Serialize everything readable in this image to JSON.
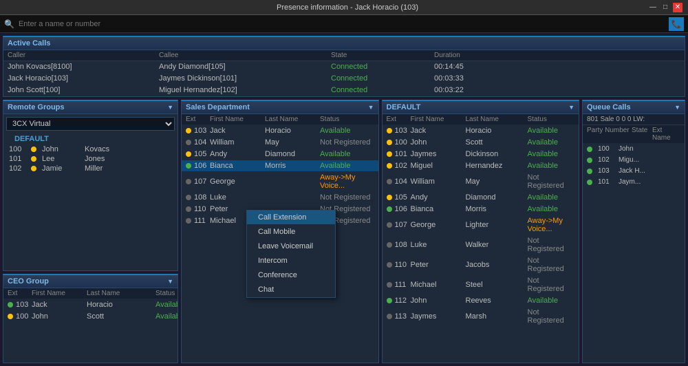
{
  "titlebar": {
    "title": "Presence information - Jack Horacio (103)",
    "min_btn": "—",
    "max_btn": "□",
    "close_btn": "✕"
  },
  "search": {
    "placeholder": "Enter a name or number"
  },
  "active_calls": {
    "label": "Active Calls",
    "headers": [
      "Caller",
      "Callee",
      "State",
      "Duration"
    ],
    "rows": [
      {
        "caller": "John Kovacs[8100]",
        "callee": "Andy Diamond[105]",
        "state": "Connected",
        "duration": "00:14:45"
      },
      {
        "caller": "Jack Horacio[103]",
        "callee": "Jaymes Dickinson[101]",
        "state": "Connected",
        "duration": "00:03:33"
      },
      {
        "caller": "John Scott[100]",
        "callee": "Miguel Hernandez[102]",
        "state": "Connected",
        "duration": "00:03:22"
      }
    ]
  },
  "remote_groups": {
    "label": "Remote Groups",
    "dropdown": "3CX Virtual",
    "group_name": "DEFAULT",
    "members": [
      {
        "ext": "100",
        "first": "John",
        "last": "Kovacs",
        "status": "yellow"
      },
      {
        "ext": "101",
        "first": "Lee",
        "last": "Jones",
        "status": "yellow"
      },
      {
        "ext": "102",
        "first": "Jamie",
        "last": "Miller",
        "status": "yellow"
      }
    ]
  },
  "ceo_group": {
    "label": "CEO Group",
    "headers": [
      "Ext",
      "First Name",
      "Last Name",
      "Status"
    ],
    "rows": [
      {
        "ext": "103",
        "first": "Jack",
        "last": "Horacio",
        "status": "Available",
        "dot": "green"
      },
      {
        "ext": "100",
        "first": "John",
        "last": "Scott",
        "status": "Available",
        "dot": "yellow"
      }
    ]
  },
  "sales_dept": {
    "label": "Sales Department",
    "headers": [
      "Ext",
      "First Name",
      "Last Name",
      "Status"
    ],
    "rows": [
      {
        "ext": "103",
        "first": "Jack",
        "last": "Horacio",
        "status": "Available",
        "dot": "yellow"
      },
      {
        "ext": "104",
        "first": "William",
        "last": "May",
        "status": "Not Registered",
        "dot": "gray"
      },
      {
        "ext": "105",
        "first": "Andy",
        "last": "Diamond",
        "status": "Available",
        "dot": "yellow"
      },
      {
        "ext": "106",
        "first": "Bianca",
        "last": "Morris",
        "status": "Available",
        "dot": "green",
        "selected": true
      },
      {
        "ext": "107",
        "first": "George",
        "last": "",
        "status": "Away->My Voice...",
        "dot": "gray"
      },
      {
        "ext": "108",
        "first": "Luke",
        "last": "",
        "status": "Not Registered",
        "dot": "gray"
      },
      {
        "ext": "110",
        "first": "Peter",
        "last": "",
        "status": "Not Registered",
        "dot": "gray"
      },
      {
        "ext": "111",
        "first": "Michael",
        "last": "",
        "status": "Not Registered",
        "dot": "gray"
      }
    ]
  },
  "context_menu": {
    "items": [
      "Call Extension",
      "Call Mobile",
      "Leave Voicemail",
      "Intercom",
      "Conference",
      "Chat"
    ]
  },
  "default_panel": {
    "label": "DEFAULT",
    "headers": [
      "Ext",
      "First Name",
      "Last Name",
      "Status"
    ],
    "rows": [
      {
        "ext": "103",
        "first": "Jack",
        "last": "Horacio",
        "status": "Available",
        "dot": "yellow"
      },
      {
        "ext": "100",
        "first": "John",
        "last": "Scott",
        "status": "Available",
        "dot": "yellow"
      },
      {
        "ext": "101",
        "first": "Jaymes",
        "last": "Dickinson",
        "status": "Available",
        "dot": "yellow"
      },
      {
        "ext": "102",
        "first": "Miguel",
        "last": "Hernandez",
        "status": "Available",
        "dot": "yellow"
      },
      {
        "ext": "104",
        "first": "William",
        "last": "May",
        "status": "Not Registered",
        "dot": "gray"
      },
      {
        "ext": "105",
        "first": "Andy",
        "last": "Diamond",
        "status": "Available",
        "dot": "yellow"
      },
      {
        "ext": "106",
        "first": "Bianca",
        "last": "Morris",
        "status": "Available",
        "dot": "green"
      },
      {
        "ext": "107",
        "first": "George",
        "last": "Lighter",
        "status": "Away->My Voice...",
        "dot": "gray"
      },
      {
        "ext": "108",
        "first": "Luke",
        "last": "Walker",
        "status": "Not Registered",
        "dot": "gray"
      },
      {
        "ext": "110",
        "first": "Peter",
        "last": "Jacobs",
        "status": "Not Registered",
        "dot": "gray"
      },
      {
        "ext": "111",
        "first": "Michael",
        "last": "Steel",
        "status": "Not Registered",
        "dot": "gray"
      },
      {
        "ext": "112",
        "first": "John",
        "last": "Reeves",
        "status": "Available",
        "dot": "green"
      },
      {
        "ext": "113",
        "first": "Jaymes",
        "last": "Marsh",
        "status": "Not Registered",
        "dot": "gray"
      }
    ]
  },
  "queue_calls": {
    "label": "Queue Calls",
    "bar": "801 Sale 0  0  0  LW:",
    "headers": [
      "Party Number",
      "State",
      "",
      "Ext",
      "Name"
    ],
    "rows": [
      {
        "ext": "100",
        "name": "John",
        "dot": "green"
      },
      {
        "ext": "102",
        "name": "Migu...",
        "dot": "green"
      },
      {
        "ext": "103",
        "name": "Jack H...",
        "dot": "green"
      },
      {
        "ext": "101",
        "name": "Jaym...",
        "dot": "green"
      }
    ]
  }
}
